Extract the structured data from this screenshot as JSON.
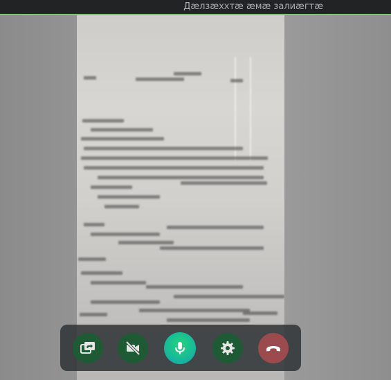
{
  "window": {
    "title": "Дæлзæхxтæ æмæ залиæгтæ"
  },
  "controls": {
    "buttons": [
      {
        "name": "screen-share",
        "icon": "screen-share-icon",
        "color": "#1e5a34"
      },
      {
        "name": "video-off",
        "icon": "video-off-icon",
        "color": "#1e5a34"
      },
      {
        "name": "microphone",
        "icon": "microphone-icon",
        "color": "#18b89a"
      },
      {
        "name": "settings",
        "icon": "gear-icon",
        "color": "#1e5a34"
      },
      {
        "name": "hang-up",
        "icon": "phone-hangup-icon",
        "color": "#9b4b4e"
      }
    ]
  },
  "colors": {
    "accent": "#84c27a",
    "hangup": "#9b4b4e",
    "active": "#18b89a"
  }
}
